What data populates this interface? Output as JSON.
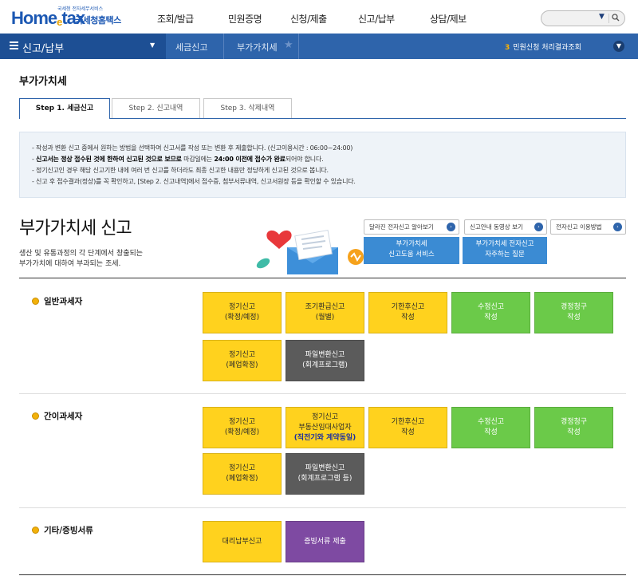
{
  "header": {
    "logo_text": "Home",
    "logo_e": "e",
    "logo_tax": "tax",
    "logo_small": "국세청 전자세무서비스",
    "logo_kr": "국세청홈택스",
    "menu": [
      "조회/발급",
      "민원증명",
      "신청/제출",
      "신고/납부",
      "상담/제보"
    ]
  },
  "search": {
    "placeholder": "",
    "dropdown_icon": "chevron-down-icon",
    "search_icon": "magnifier-icon"
  },
  "navbar": {
    "menu_label": "신고/납부",
    "breadcrumb": [
      "세금신고",
      "부가가치세"
    ],
    "notice_count": "3",
    "notice_text": "민원신청 처리결과조회"
  },
  "page": {
    "title": "부가가치세"
  },
  "tabs": [
    {
      "label": "Step 1. 세금신고",
      "active": true
    },
    {
      "label": "Step 2. 신고내역",
      "active": false
    },
    {
      "label": "Step 3. 삭제내역",
      "active": false
    }
  ],
  "info": {
    "line1": "작성과 변환 신고 중에서 원하는 방법을 선택하여 신고서를 작성 또는 변환 후 제출합니다. (신고이용시간 : 06:00~24:00)",
    "line2_bold1": "신고서는 정상 접수된 것에 한하여 신고된 것으로 보므로",
    "line2_mid": " 마감일에는 ",
    "line2_bold2": "24:00 이전에 접수가 완료",
    "line2_end": "되어야 합니다.",
    "line3": "정기신고인 경우 해당 신고기한 내에 여러 번 신고를 하더라도 최종 신고한 내용만 정당하게 신고된 것으로 봅니다.",
    "line4": "신고 후 접수결과(정상)를 꼭 확인하고, [Step 2. 신고내역]에서 접수증, 첨부서류내역, 신고서원장 등을 확인할 수 있습니다."
  },
  "vat": {
    "title": "부가가치세 신고",
    "desc1": "생산 및 유통과정의 각 단계에서 창출되는",
    "desc2": "부가가치에 대하여 부과되는 조세.",
    "links": [
      "달라진 전자신고 알아보기",
      "신고안내 동영상 보기",
      "전자신고 이용방법"
    ],
    "blue_buttons": [
      {
        "line1": "부가가치세",
        "line2": "신고도움 서비스"
      },
      {
        "line1": "부가가치세 전자신고",
        "line2": "자주하는 질문"
      }
    ]
  },
  "sections": [
    {
      "label": "일반과세자",
      "buttons": [
        {
          "l1": "정기신고",
          "l2": "(확정/예정)",
          "color": "#ffd21e"
        },
        {
          "l1": "조기환급신고",
          "l2": "(월별)",
          "color": "#ffd21e"
        },
        {
          "l1": "기한후신고",
          "l2": "작성",
          "color": "#ffd21e"
        },
        {
          "l1": "수정신고",
          "l2": "작성",
          "color": "#6bca49"
        },
        {
          "l1": "경정청구",
          "l2": "작성",
          "color": "#6bca49"
        },
        {
          "l1": "정기신고",
          "l2": "(폐업확정)",
          "color": "#ffd21e"
        },
        {
          "l1": "파일변환신고",
          "l2": "(회계프로그램)",
          "color": "#5b5b5b"
        }
      ]
    },
    {
      "label": "간이과세자",
      "buttons": [
        {
          "l1": "정기신고",
          "l2": "(확정/예정)",
          "color": "#ffd21e"
        },
        {
          "l1": "정기신고",
          "l2": "부동산임대사업자",
          "l3": "(직전기와 계약동일)",
          "color": "#ffd21e"
        },
        {
          "l1": "기한후신고",
          "l2": "작성",
          "color": "#ffd21e"
        },
        {
          "l1": "수정신고",
          "l2": "작성",
          "color": "#6bca49"
        },
        {
          "l1": "경정청구",
          "l2": "작성",
          "color": "#6bca49"
        },
        {
          "l1": "정기신고",
          "l2": "(폐업확정)",
          "color": "#ffd21e"
        },
        {
          "l1": "파일변환신고",
          "l2": "(회계프로그램 등)",
          "color": "#5b5b5b"
        }
      ]
    },
    {
      "label": "기타/증빙서류",
      "buttons": [
        {
          "l1": "대리납부신고",
          "color": "#ffd21e"
        },
        {
          "l1": "증빙서류 제출",
          "color": "#7e4aa2"
        }
      ]
    }
  ]
}
